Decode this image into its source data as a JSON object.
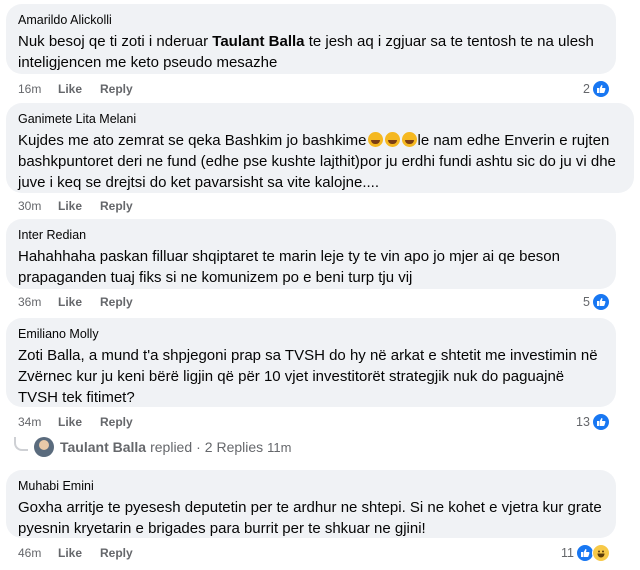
{
  "comments": [
    {
      "author": "Amarildo Alickolli",
      "text_parts": [
        "Nuk besoj qe ti zoti i nderuar ",
        "Taulant Balla",
        " te jesh aq i zgjuar sa te tentosh te na ulesh inteligjencen me keto pseudo mesazhe"
      ],
      "time": "16m",
      "like": "Like",
      "reply": "Reply",
      "reaction_count": "2"
    },
    {
      "author": "Ganimete Lita Melani",
      "text_parts": [
        "Kujdes me ato zemrat se qeka Bashkim jo bashkime",
        "le nam edhe Enverin e rujten bashkpuntoret deri ne fund (edhe pse kushte lajthit)por ju erdhi fundi ashtu sic do ju vi dhe juve i keq se drejtsi do ket pavarsisht sa vite kalojne...."
      ],
      "time": "30m",
      "like": "Like",
      "reply": "Reply"
    },
    {
      "author": "Inter Redian",
      "text": "Hahahhaha paskan filluar shqiptaret te marin leje ty te vin apo jo mjer ai qe beson prapaganden tuaj fiks si ne komunizem po e beni turp tju vij",
      "time": "36m",
      "like": "Like",
      "reply": "Reply",
      "reaction_count": "5"
    },
    {
      "author": "Emiliano Molly",
      "text": "Zoti Balla, a mund t'a shpjegoni prap sa TVSH do hy në arkat e shtetit me investimin në Zvërnec kur ju keni bërë ligjin që për 10 vjet investitorët strategjik nuk do paguajnë TVSH tek fitimet?",
      "time": "34m",
      "like": "Like",
      "reply": "Reply",
      "reaction_count": "13"
    },
    {
      "author": "Muhabi Emini",
      "text": "Goxha arritje te pyesesh deputetin per te ardhur ne shtepi. Si ne kohet e vjetra kur grate pyesnin kryetarin e brigades para burrit per te shkuar ne gjini!",
      "time": "46m",
      "like": "Like",
      "reply": "Reply",
      "reaction_count": "11"
    }
  ],
  "replies": {
    "name": "Taulant Balla",
    "label": "replied",
    "separator": "·",
    "count": "2 Replies",
    "time": "11m"
  }
}
